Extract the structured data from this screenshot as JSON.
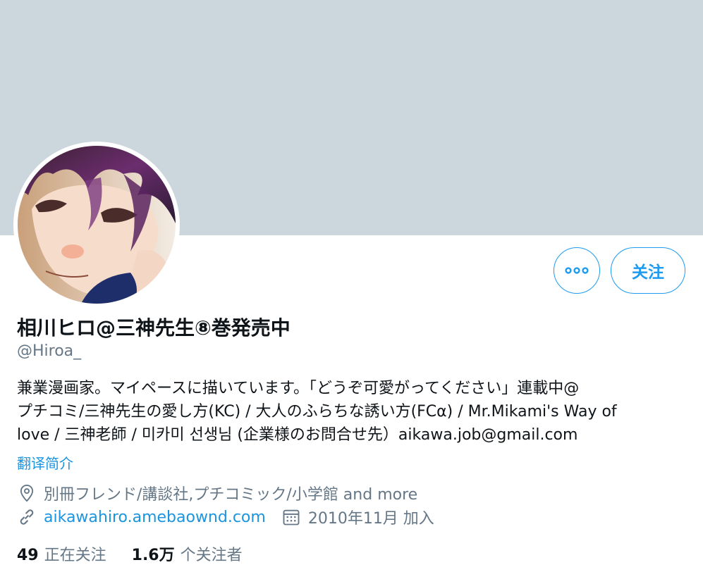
{
  "profile": {
    "display_name": "相川ヒロ@三神先生⑧巻発売中",
    "handle": "@Hiroa_",
    "bio_lines": [
      "兼業漫画家。マイペースに描いています。「どうぞ可愛がってください」連載中@",
      "プチコミ/三神先生の愛し方(KC) / 大人のふらちな誘い方(FCα) /  Mr.Mikami's Way of",
      "love / 三神老師 / 미카미 선생님 (企業様のお問合せ先）aikawa.job@gmail.com"
    ],
    "translate_label": "翻译简介",
    "location": "別冊フレンド/講談社,プチコミック/小学館 and more",
    "url": "aikawahiro.amebaownd.com",
    "joined": "2010年11月 加入"
  },
  "actions": {
    "more_label": "•••",
    "follow_label": "关注"
  },
  "stats": {
    "following_count": "49",
    "following_label": "正在关注",
    "followers_count": "1.6万",
    "followers_label": "个关注者"
  },
  "colors": {
    "banner": "#ccd6dd",
    "accent": "#1d9bf0",
    "link": "#1b95e0",
    "muted": "#657786"
  },
  "icons": {
    "location": "location-pin-icon",
    "url": "link-icon",
    "joined": "calendar-icon",
    "more": "more-dots-icon"
  }
}
